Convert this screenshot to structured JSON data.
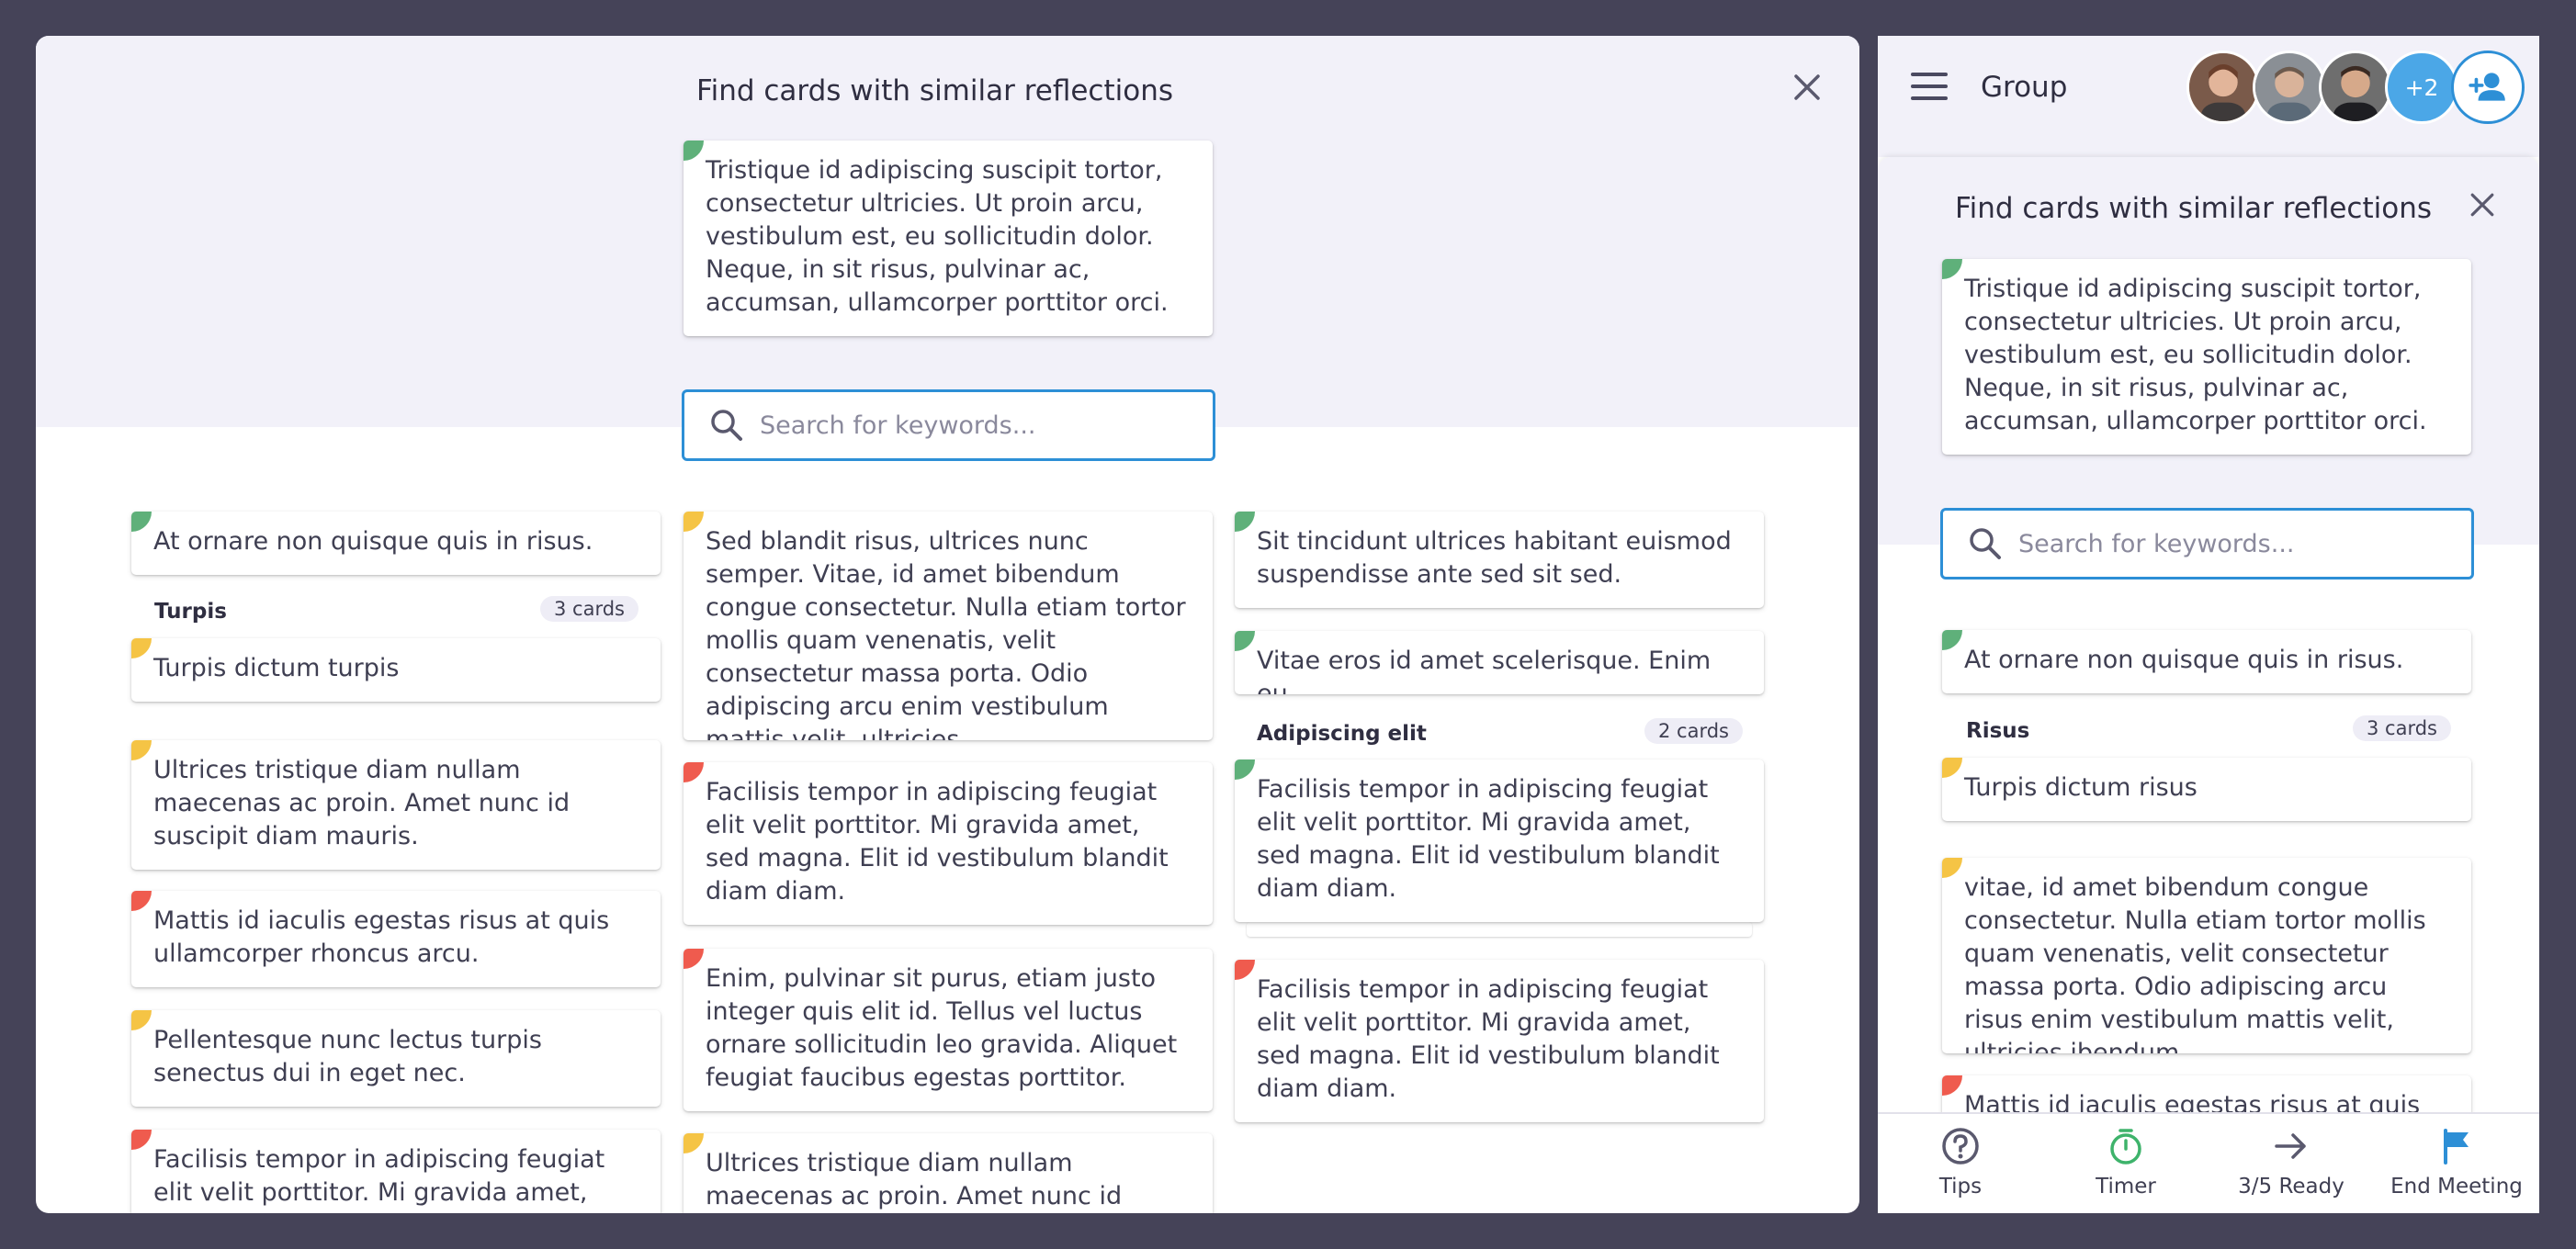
{
  "desktop": {
    "title": "Find cards with similar reflections",
    "reference_card": {
      "text": "Tristique id adipiscing suscipit tortor, consectetur ultricies. Ut proin arcu, vestibulum est, eu sollicitudin dolor. Neque, in sit risus, pulvinar ac, accumsan, ullamcorper porttitor orci.",
      "color": "green"
    },
    "search": {
      "placeholder": "Search for keywords..."
    },
    "col1": {
      "card1": "At ornare non quisque quis in risus.",
      "group_title": "Turpis",
      "group_count": "3 cards",
      "group_card": "Turpis dictum turpis",
      "card2": "Ultrices tristique diam nullam maecenas ac proin. Amet nunc id suscipit diam mauris.",
      "card3": "Mattis id iaculis egestas risus at quis ullamcorper rhoncus arcu.",
      "card4": "Pellentesque nunc lectus turpis senectus dui in eget nec.",
      "card5": "Facilisis tempor in adipiscing feugiat elit velit porttitor. Mi gravida amet, sed"
    },
    "col2": {
      "card1": "Sed blandit risus, ultrices nunc semper. Vitae, id amet bibendum congue consectetur. Nulla etiam tortor mollis quam venenatis, velit consectetur massa porta. Odio adipiscing arcu enim vestibulum mattis velit, ultricies.",
      "card2": "Facilisis tempor in adipiscing feugiat elit velit porttitor. Mi gravida amet, sed magna. Elit id vestibulum blandit diam diam.",
      "card3": "Enim, pulvinar sit purus, etiam justo integer quis elit id. Tellus vel luctus ornare sollicitudin leo gravida. Aliquet feugiat faucibus egestas porttitor.",
      "card4": "Ultrices tristique diam nullam maecenas ac proin. Amet nunc id suscipit diam"
    },
    "col3": {
      "card1": "Sit tincidunt ultrices habitant euismod suspendisse ante sed sit sed.",
      "card2": "Vitae eros id amet scelerisque. Enim eu.",
      "group_title": "Adipiscing elit",
      "group_count": "2 cards",
      "group_card": "Facilisis tempor in adipiscing feugiat elit velit porttitor. Mi gravida amet, sed magna. Elit id vestibulum blandit diam diam.",
      "card3": "Facilisis tempor in adipiscing feugiat elit velit porttitor. Mi gravida amet, sed magna. Elit id vestibulum blandit diam diam."
    }
  },
  "mobile": {
    "header_title": "Group",
    "avatar_more": "+2",
    "sheet_title": "Find cards with similar reflections",
    "reference_card": "Tristique id adipiscing suscipit tortor, consectetur ultricies. Ut proin arcu, vestibulum est, eu sollicitudin dolor. Neque, in sit risus, pulvinar ac, accumsan, ullamcorper porttitor orci.",
    "search": {
      "placeholder": "Search for keywords..."
    },
    "card1": "At ornare non quisque quis in risus.",
    "group_title": "Risus",
    "group_count": "3 cards",
    "group_card": "Turpis dictum risus",
    "card2": "vitae, id amet bibendum congue consectetur. Nulla etiam tortor mollis quam venenatis, velit consectetur massa porta. Odio adipiscing arcu risus enim vestibulum mattis velit, ultricies ibendum",
    "card3": "Mattis id iaculis egestas risus at quis",
    "footer": {
      "tips": "Tips",
      "timer": "Timer",
      "ready": "3/5 Ready",
      "end": "End Meeting"
    }
  },
  "colors": {
    "accent": "#2d8fd6",
    "green": "#5fb07a",
    "yellow": "#f5c445",
    "red": "#ef5b4e",
    "timer_green": "#3eb36b",
    "flag_blue": "#2d8fd6"
  }
}
